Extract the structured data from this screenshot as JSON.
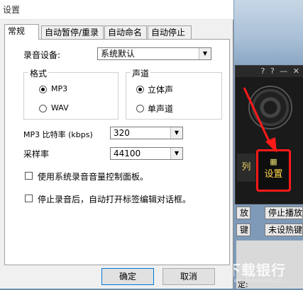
{
  "dialog": {
    "title": "设置",
    "tabs": [
      "常规",
      "自动暂停/重录",
      "自动命名",
      "自动停止"
    ],
    "device_label": "录音设备:",
    "device_value": "系统默认",
    "format_group": "格式",
    "format_options": [
      "MP3",
      "WAV"
    ],
    "channel_group": "声道",
    "channel_options": [
      "立体声",
      "单声道"
    ],
    "bitrate_label": "MP3 比特率 (kbps)",
    "bitrate_value": "320",
    "samplerate_label": "采样率",
    "samplerate_value": "44100",
    "check_system_mixer": "使用系统录音音量控制面板。",
    "check_open_tag_dialog": "停止录音后，自动打开标签编辑对话框。",
    "ok_button": "确定",
    "cancel_button": "取消"
  },
  "background": {
    "panel_controls": "? ? — ✕",
    "list_button": "列",
    "settings_button": "设置",
    "settings_icon": "settings-icon",
    "row1": [
      "放",
      "停止播放"
    ],
    "row2": [
      "键",
      "未设热键"
    ],
    "bottom_text": "定:",
    "watermark_title": "下载银行",
    "watermark_sub": "www.downbank.cn"
  },
  "colors": {
    "highlight": "#ff1a1a",
    "dialog_bg": "#f0f0f0"
  }
}
